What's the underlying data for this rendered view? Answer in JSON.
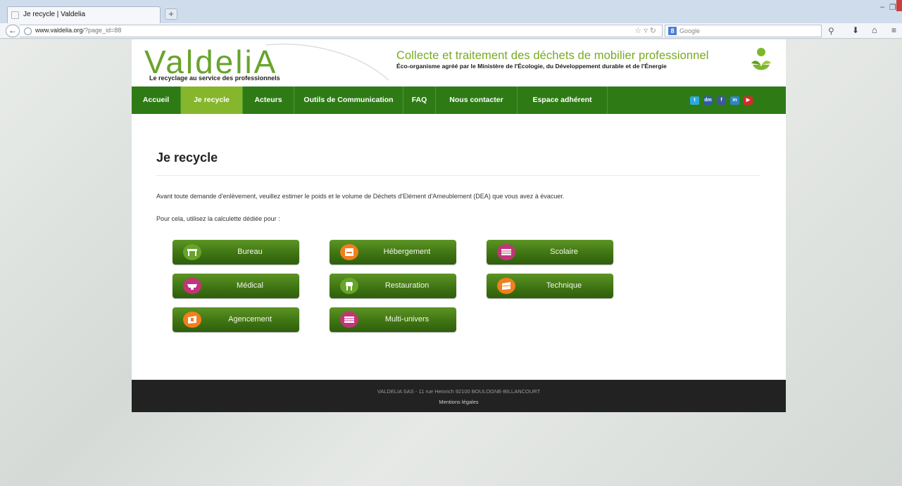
{
  "browser": {
    "tab_title": "Je recycle | Valdelia",
    "url_domain": "www.valdelia.org",
    "url_path": "/?page_id=88",
    "search_placeholder": "Google",
    "new_tab": "+",
    "back": "←",
    "minimize": "–",
    "restore": "❐"
  },
  "header": {
    "logo_text": "ValdeliA",
    "tagline": "Le recyclage au service des professionnels",
    "title": "Collecte et traitement des déchets de mobilier professionnel",
    "subtitle": "Éco-organisme agréé par le Ministère de l'Écologie, du Développement durable et de l'Énergie"
  },
  "nav": {
    "items": [
      {
        "label": "Accueil"
      },
      {
        "label": "Je recycle",
        "active": true
      },
      {
        "label": "Acteurs"
      },
      {
        "label": "Outils de Communication"
      },
      {
        "label": "FAQ"
      },
      {
        "label": "Nous contacter"
      },
      {
        "label": "Espace adhérent"
      }
    ],
    "social": [
      {
        "icon": "twitter-icon",
        "glyph": "t",
        "color": "#2aa9e0"
      },
      {
        "icon": "dailymotion-icon",
        "glyph": "dm",
        "color": "#2a5fa8"
      },
      {
        "icon": "facebook-icon",
        "glyph": "f",
        "color": "#3b5998"
      },
      {
        "icon": "linkedin-icon",
        "glyph": "in",
        "color": "#2c86c5"
      },
      {
        "icon": "youtube-icon",
        "glyph": "▶",
        "color": "#d52b2b"
      }
    ]
  },
  "main": {
    "title": "Je recycle",
    "intro": "Avant toute demande d'enlèvement, veuillez estimer le poids et le volume de Déchets d'Elément d'Ameublement (DEA) que vous avez à évacuer.",
    "prompt": "Pour cela, utilisez la calculette dédiée pour :",
    "calculators": [
      {
        "label": "Bureau",
        "icon": "office-desk-icon",
        "color": "#67a42a"
      },
      {
        "label": "Hébergement",
        "icon": "bed-icon",
        "color": "#f07f1d"
      },
      {
        "label": "Scolaire",
        "icon": "school-desk-icon",
        "color": "#c2357a"
      },
      {
        "label": "Médical",
        "icon": "medical-bed-icon",
        "color": "#c2357a"
      },
      {
        "label": "Restauration",
        "icon": "chair-icon",
        "color": "#67a42a"
      },
      {
        "label": "Technique",
        "icon": "shelving-icon",
        "color": "#f07f1d"
      },
      {
        "label": "Agencement",
        "icon": "cabinet-icon",
        "color": "#f07f1d"
      },
      {
        "label": "Multi-univers",
        "icon": "multi-furniture-icon",
        "color": "#c2357a"
      }
    ]
  },
  "footer": {
    "address": "VALDELIA SAS - 11 rue Heinrich 92100 BOULOGNE-BILLANCOURT",
    "legal": "Mentions légales"
  },
  "colors": {
    "nav_green": "#2e7b16",
    "nav_active": "#86b62b",
    "brand_green": "#68a42c",
    "footer_bg": "#222222"
  }
}
